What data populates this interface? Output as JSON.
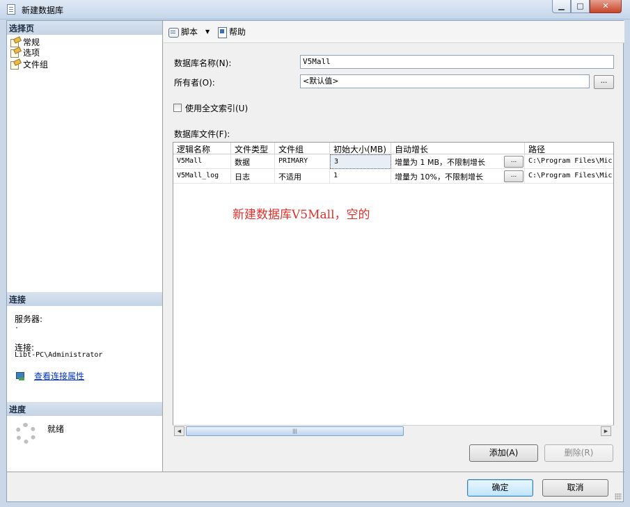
{
  "window": {
    "title": "新建数据库"
  },
  "left_pane": {
    "select_page_header": "选择页",
    "pages": [
      {
        "label": "常规",
        "icon": "page-icon"
      },
      {
        "label": "选项",
        "icon": "page-icon"
      },
      {
        "label": "文件组",
        "icon": "page-icon"
      }
    ],
    "connection": {
      "header": "连接",
      "server_label": "服务器:",
      "server_value": ".",
      "connection_label": "连接:",
      "connection_value": "Libt-PC\\Administrator",
      "view_properties_link": "查看连接属性"
    },
    "progress": {
      "header": "进度",
      "status": "就绪"
    }
  },
  "toolbar": {
    "script_label": "脚本",
    "help_label": "帮助"
  },
  "form": {
    "db_name_label": "数据库名称(N):",
    "db_name_value": "V5Mall",
    "owner_label": "所有者(O):",
    "owner_value": "<默认值>",
    "owner_browse": "...",
    "fulltext_label": "使用全文索引(U)",
    "fulltext_checked": false,
    "files_label": "数据库文件(F):"
  },
  "files_grid": {
    "columns": [
      "逻辑名称",
      "文件类型",
      "文件组",
      "初始大小(MB)",
      "自动增长",
      "路径"
    ],
    "rows": [
      {
        "logical_name": "V5Mall",
        "file_type": "数据",
        "filegroup": "PRIMARY",
        "initial_size": "3",
        "autogrowth": "增量为 1 MB，不限制增长",
        "browse": "...",
        "path": "C:\\Program Files\\Micr"
      },
      {
        "logical_name": "V5Mall_log",
        "file_type": "日志",
        "filegroup": "不适用",
        "initial_size": "1",
        "autogrowth": "增量为 10%，不限制增长",
        "browse": "...",
        "path": "C:\\Program Files\\Micr"
      }
    ],
    "annotation": "新建数据库V5Mall，空的"
  },
  "grid_buttons": {
    "add": "添加(A)",
    "remove": "删除(R)"
  },
  "dialog_buttons": {
    "ok": "确定",
    "cancel": "取消"
  },
  "colors": {
    "annotation": "#e0302a",
    "section_header": "#c6d4e5",
    "link": "#0033cc"
  }
}
